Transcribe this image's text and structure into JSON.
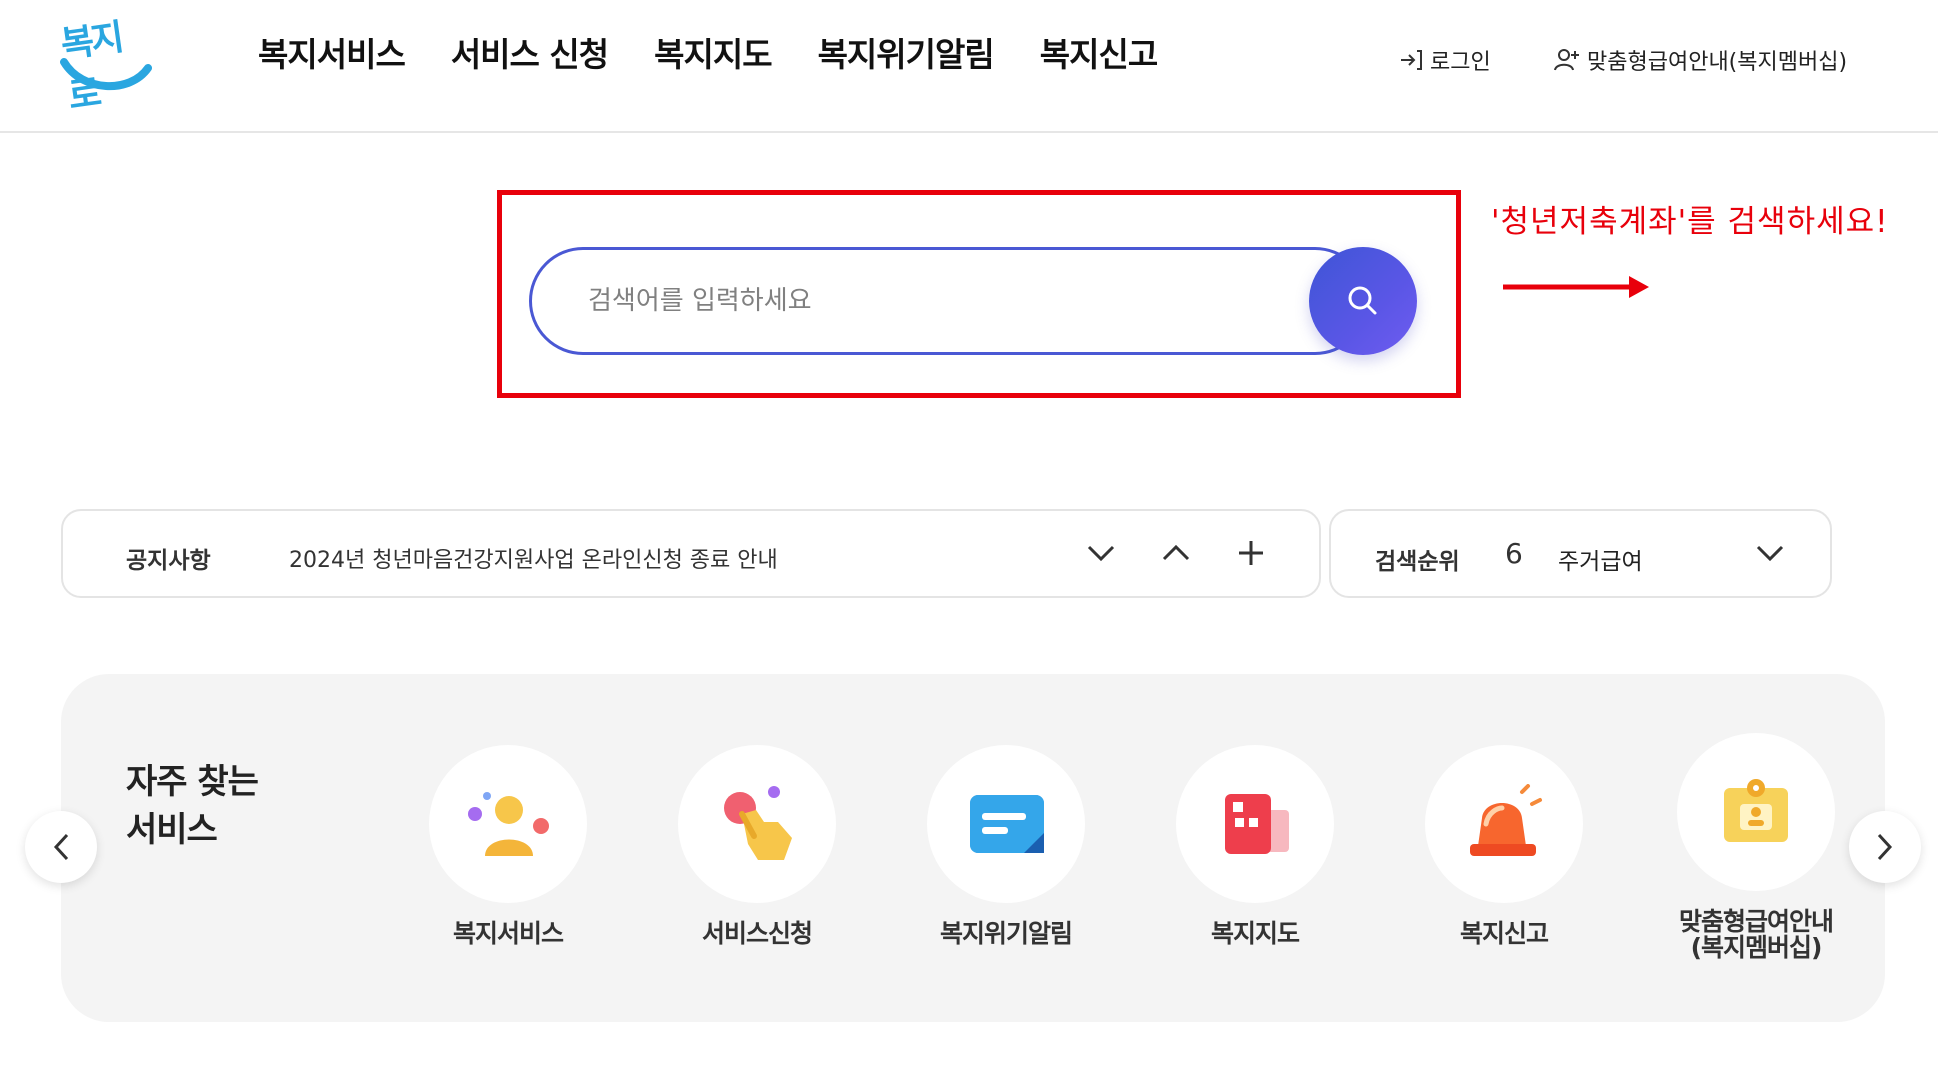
{
  "header": {
    "logo_text": "복지로",
    "nav": [
      "복지서비스",
      "서비스 신청",
      "복지지도",
      "복지위기알림",
      "복지신고"
    ],
    "login_label": "로그인",
    "member_label": "맞춤형급여안내(복지멤버십)"
  },
  "search": {
    "placeholder": "검색어를 입력하세요",
    "value": "",
    "button_icon": "search-icon"
  },
  "annotation": {
    "text": "'청년저축계좌'를 검색하세요!",
    "color": "#e8000b"
  },
  "notice": {
    "label": "공지사항",
    "text": "2024년 청년마음건강지원사업 온라인신청 종료 안내"
  },
  "rank": {
    "label": "검색순위",
    "number": "6",
    "keyword": "주거급여"
  },
  "frequent": {
    "title_line1": "자주 찾는",
    "title_line2": "서비스",
    "items": [
      {
        "label": "복지서비스",
        "icon": "person-icon"
      },
      {
        "label": "서비스신청",
        "icon": "hand-tap-icon"
      },
      {
        "label": "복지위기알림",
        "icon": "message-icon"
      },
      {
        "label": "복지지도",
        "icon": "map-icon"
      },
      {
        "label": "복지신고",
        "icon": "siren-icon"
      },
      {
        "label": "맞춤형급여안내\n(복지멤버십)",
        "icon": "id-badge-icon"
      }
    ]
  },
  "colors": {
    "accent": "#4a58d4",
    "highlight": "#e8000b",
    "logo": "#2aa6e0"
  }
}
